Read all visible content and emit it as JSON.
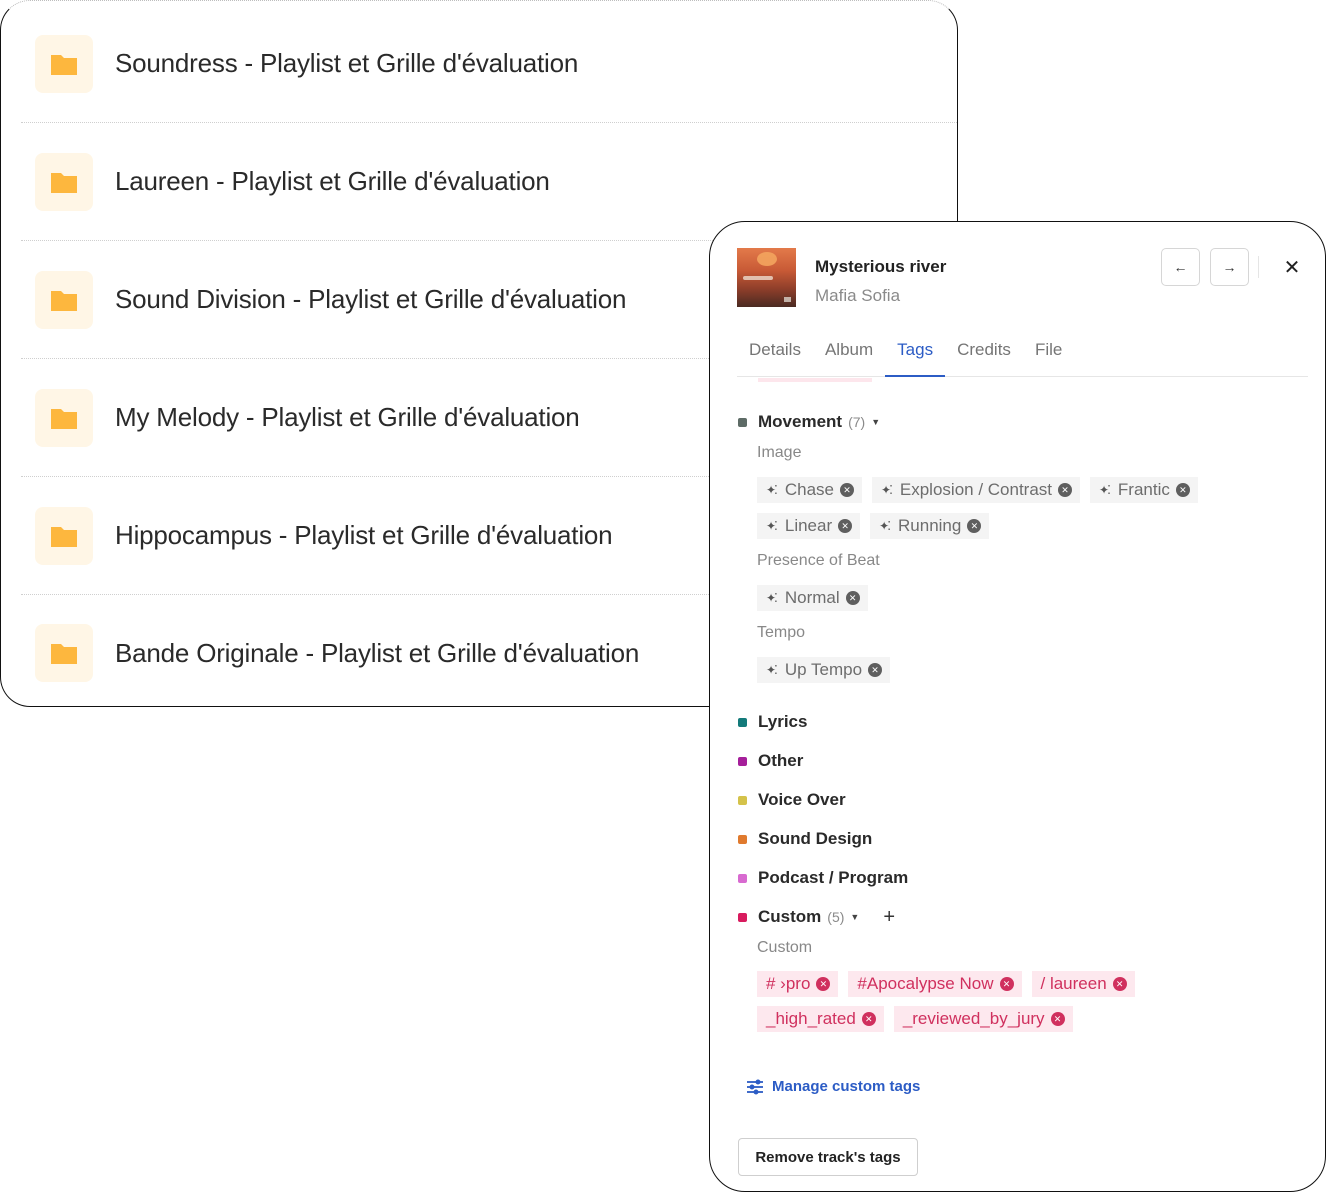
{
  "folders": [
    {
      "name": "Soundress - Playlist et Grille d'évaluation"
    },
    {
      "name": "Laureen - Playlist et Grille d'évaluation"
    },
    {
      "name": "Sound Division - Playlist et Grille d'évaluation"
    },
    {
      "name": "My Melody - Playlist et Grille d'évaluation"
    },
    {
      "name": "Hippocampus - Playlist et Grille d'évaluation"
    },
    {
      "name": "Bande Originale - Playlist et Grille d'évaluation"
    }
  ],
  "track": {
    "title": "Mysterious river",
    "artist": "Mafia Sofia",
    "prev_icon": "←",
    "next_icon": "→",
    "close_icon": "✕"
  },
  "tabs": [
    {
      "label": "Details"
    },
    {
      "label": "Album"
    },
    {
      "label": "Tags",
      "active": true
    },
    {
      "label": "Credits"
    },
    {
      "label": "File"
    }
  ],
  "tags": {
    "movement": {
      "label": "Movement",
      "count": "(7)",
      "color": "#5d6b66",
      "groups": [
        {
          "heading": "Image",
          "rows": [
            [
              "Chase",
              "Explosion / Contrast",
              "Frantic"
            ],
            [
              "Linear",
              "Running"
            ]
          ]
        },
        {
          "heading": "Presence of Beat",
          "rows": [
            [
              "Normal"
            ]
          ]
        },
        {
          "heading": "Tempo",
          "rows": [
            [
              "Up Tempo"
            ]
          ]
        }
      ]
    },
    "collapsed": [
      {
        "label": "Lyrics",
        "color": "#137a7a"
      },
      {
        "label": "Other",
        "color": "#a51f9a"
      },
      {
        "label": "Voice Over",
        "color": "#d4c24a"
      },
      {
        "label": "Sound Design",
        "color": "#e07a2e"
      },
      {
        "label": "Podcast / Program",
        "color": "#d86ad0"
      }
    ],
    "custom": {
      "label": "Custom",
      "count": "(5)",
      "color": "#d81b5e",
      "heading": "Custom",
      "rows": [
        [
          "# ›pro",
          "#Apocalypse Now",
          "/ laureen"
        ],
        [
          "_high_rated",
          "_reviewed_by_jury"
        ]
      ]
    }
  },
  "icons": {
    "spark": "✦⁚",
    "remove": "✕",
    "caret": "▼",
    "plus": "+"
  },
  "actions": {
    "manage_custom_tags": "Manage custom tags",
    "remove_track_tags": "Remove track's tags"
  }
}
